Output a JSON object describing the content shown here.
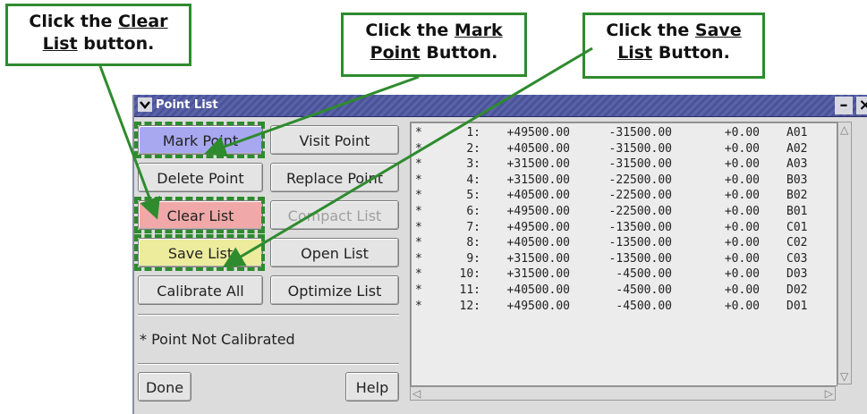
{
  "window": {
    "title": "Point List",
    "buttons": {
      "mark_point": "Mark Point",
      "visit_point": "Visit Point",
      "delete_point": "Delete Point",
      "replace_point": "Replace Point",
      "clear_list": "Clear List",
      "compact_list": "Compact List",
      "save_list": "Save List",
      "open_list": "Open List",
      "calibrate_all": "Calibrate All",
      "optimize_list": "Optimize List",
      "done": "Done",
      "help": "Help"
    },
    "note": "* Point Not Calibrated",
    "points": [
      {
        "flag": "*",
        "num": "1:",
        "x": "+49500.00",
        "y": "-31500.00",
        "z": "+0.00",
        "id": "A01"
      },
      {
        "flag": "*",
        "num": "2:",
        "x": "+40500.00",
        "y": "-31500.00",
        "z": "+0.00",
        "id": "A02"
      },
      {
        "flag": "*",
        "num": "3:",
        "x": "+31500.00",
        "y": "-31500.00",
        "z": "+0.00",
        "id": "A03"
      },
      {
        "flag": "*",
        "num": "4:",
        "x": "+31500.00",
        "y": "-22500.00",
        "z": "+0.00",
        "id": "B03"
      },
      {
        "flag": "*",
        "num": "5:",
        "x": "+40500.00",
        "y": "-22500.00",
        "z": "+0.00",
        "id": "B02"
      },
      {
        "flag": "*",
        "num": "6:",
        "x": "+49500.00",
        "y": "-22500.00",
        "z": "+0.00",
        "id": "B01"
      },
      {
        "flag": "*",
        "num": "7:",
        "x": "+49500.00",
        "y": "-13500.00",
        "z": "+0.00",
        "id": "C01"
      },
      {
        "flag": "*",
        "num": "8:",
        "x": "+40500.00",
        "y": "-13500.00",
        "z": "+0.00",
        "id": "C02"
      },
      {
        "flag": "*",
        "num": "9:",
        "x": "+31500.00",
        "y": "-13500.00",
        "z": "+0.00",
        "id": "C03"
      },
      {
        "flag": "*",
        "num": "10:",
        "x": "+31500.00",
        "y": "-4500.00",
        "z": "+0.00",
        "id": "D03"
      },
      {
        "flag": "*",
        "num": "11:",
        "x": "+40500.00",
        "y": "-4500.00",
        "z": "+0.00",
        "id": "D02"
      },
      {
        "flag": "*",
        "num": "12:",
        "x": "+49500.00",
        "y": "-4500.00",
        "z": "+0.00",
        "id": "D01"
      }
    ]
  },
  "callouts": {
    "clear": {
      "pre": "Click the ",
      "u1": "Clear",
      "u2": "List",
      "post": " button."
    },
    "mark": {
      "pre": "Click the ",
      "u1": "Mark",
      "u2": "Point",
      "post": " Button."
    },
    "save": {
      "pre": "Click the ",
      "u1": "Save",
      "u2": "List",
      "post": " Button."
    }
  },
  "colors": {
    "callout_border": "#2e8b2e",
    "mark_button": "#a8a8f0",
    "clear_button": "#f0a8a8",
    "save_button": "#ecec9c",
    "titlebar": "#5a62a8"
  },
  "icons": {
    "window_menu": "chevron-down-icon",
    "minimize": "minimize-icon",
    "close": "close-icon"
  }
}
